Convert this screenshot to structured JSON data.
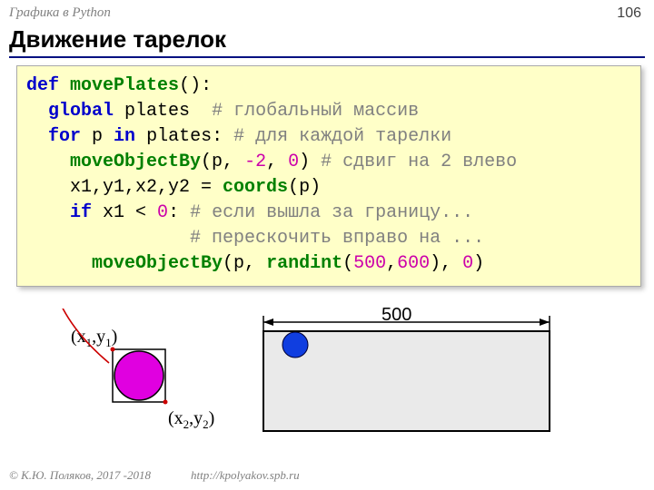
{
  "header_topic": "Графика в Python",
  "page_number": "106",
  "slide_title": "Движение тарелок",
  "code": {
    "l1_def": "def",
    "l1_fn": "movePlates",
    "l1_tail": "():",
    "l2_ind": "  ",
    "l2_kw": "global",
    "l2_var": " plates  ",
    "l2_cm": "# глобальный массив",
    "l3_ind": "  ",
    "l3_for": "for",
    "l3_mid": " p ",
    "l3_in": "in",
    "l3_tail": " plates: ",
    "l3_cm": "# для каждой тарелки",
    "l4_ind": "    ",
    "l4_fn": "moveObjectBy",
    "l4_open": "(p, ",
    "l4_n1": "-2",
    "l4_c1": ", ",
    "l4_n2": "0",
    "l4_close": ") ",
    "l4_cm": "# сдвиг на 2 влево",
    "l5": "    x1,y1,x2,y2 = ",
    "l5_fn": "coords",
    "l5_tail": "(p)",
    "l6_ind": "    ",
    "l6_if": "if",
    "l6_mid": " x1 < ",
    "l6_zero": "0",
    "l6_colon": ": ",
    "l6_cm": "# если вышла за границу...",
    "l7_ind": "               ",
    "l7_cm": "# перескочить вправо на ...",
    "l8_ind": "      ",
    "l8_fn": "moveObjectBy",
    "l8_open": "(p, ",
    "l8_rand": "randint",
    "l8_p1": "(",
    "l8_n1": "500",
    "l8_c": ",",
    "l8_n2": "600",
    "l8_p2": "), ",
    "l8_n3": "0",
    "l8_close": ")"
  },
  "coord1_open": "(x",
  "coord1_sub1": "1",
  "coord1_mid": ",y",
  "coord1_sub2": "1",
  "coord1_close": ")",
  "coord2_open": "(x",
  "coord2_sub1": "2",
  "coord2_mid": ",y",
  "coord2_sub2": "2",
  "coord2_close": ")",
  "dimension_label": "500",
  "footer_left": "© К.Ю. Поляков, 2017 -2018",
  "footer_right": "http://kpolyakov.spb.ru"
}
